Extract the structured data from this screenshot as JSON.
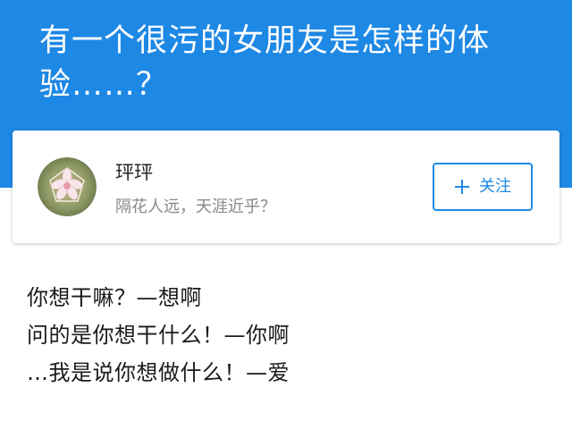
{
  "question": {
    "title": "有一个很污的女朋友是怎样的体验……？"
  },
  "author": {
    "name": "玶玶",
    "bio": "隔花人远，天涯近乎？",
    "avatar_icon": "flower-avatar-icon"
  },
  "follow_button": {
    "icon": "plus-icon",
    "label": "关注"
  },
  "answer": {
    "lines": [
      "你想干嘛？—想啊",
      "问的是你想干什么！—你啊",
      "…我是说你想做什么！—爱"
    ]
  },
  "colors": {
    "header_blue": "#1e88e5",
    "text_dark": "#1a1a1a",
    "text_gray": "#888888"
  }
}
